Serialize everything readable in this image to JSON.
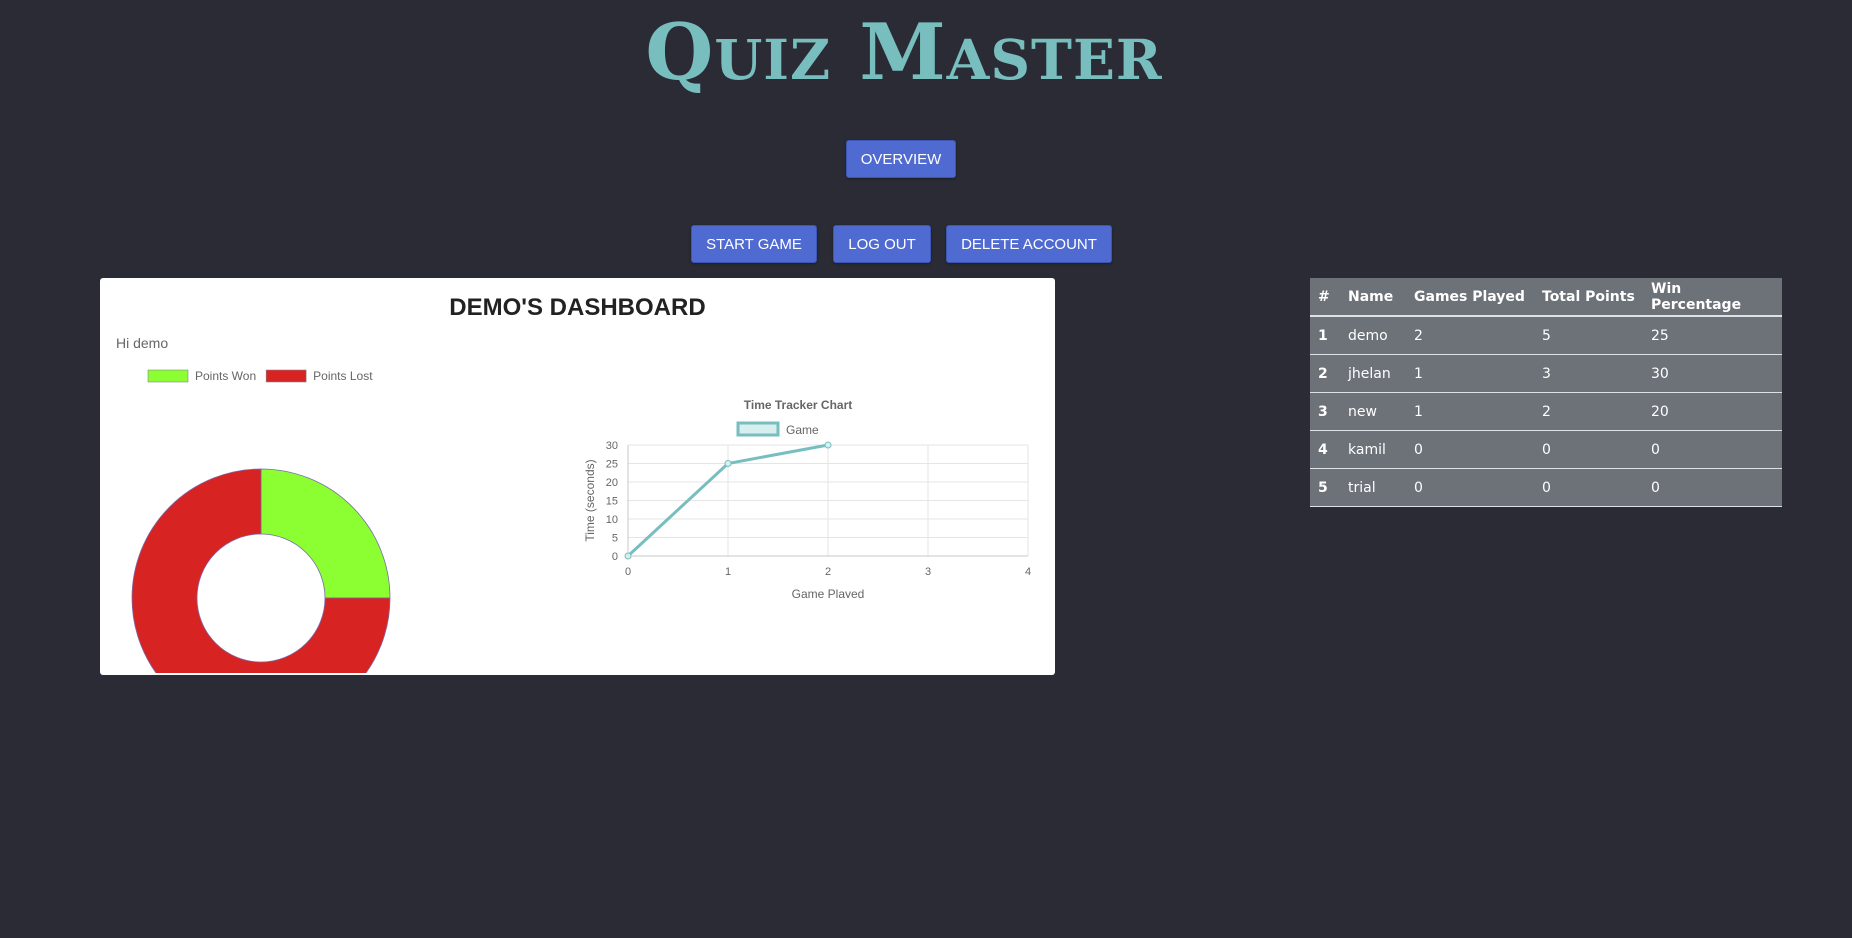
{
  "app": {
    "title": "Quiz Master"
  },
  "nav": {
    "overview_label": "OVERVIEW",
    "start_label": "START GAME",
    "logout_label": "LOG OUT",
    "delete_label": "DELETE ACCOUNT"
  },
  "dashboard": {
    "title": "DEMO'S DASHBOARD",
    "greeting": "Hi demo"
  },
  "colors": {
    "background": "#2a2b34",
    "accent": "#4f6ad1",
    "title": "#78bebe",
    "points_won": "#8cff32",
    "points_lost": "#d82323",
    "line": "#78bebe"
  },
  "leaderboard": {
    "headers": [
      "#",
      "Name",
      "Games Played",
      "Total Points",
      "Win Percentage"
    ],
    "rows": [
      [
        "1",
        "demo",
        "2",
        "5",
        "25"
      ],
      [
        "2",
        "jhelan",
        "1",
        "3",
        "30"
      ],
      [
        "3",
        "new",
        "1",
        "2",
        "20"
      ],
      [
        "4",
        "kamil",
        "0",
        "0",
        "0"
      ],
      [
        "5",
        "trial",
        "0",
        "0",
        "0"
      ]
    ]
  },
  "chart_data": [
    {
      "type": "pie",
      "variant": "doughnut",
      "legend_position": "top",
      "labels": [
        "Points Won",
        "Points Lost"
      ],
      "values": [
        25,
        75
      ],
      "colors": [
        "#8cff32",
        "#d82323"
      ]
    },
    {
      "type": "line",
      "title": "Time Tracker Chart",
      "xlabel": "Game Played",
      "ylabel": "Time (seconds)",
      "legend_position": "top",
      "grid": true,
      "xlim": [
        0,
        4
      ],
      "ylim": [
        0,
        30
      ],
      "xticks": [
        "0",
        "1",
        "2",
        "3",
        "4"
      ],
      "yticks": [
        "0",
        "5",
        "10",
        "15",
        "20",
        "25",
        "30"
      ],
      "series": [
        {
          "name": "Game",
          "x": [
            0,
            1,
            2
          ],
          "y": [
            0,
            25,
            30
          ],
          "color": "#78bebe"
        }
      ]
    }
  ]
}
